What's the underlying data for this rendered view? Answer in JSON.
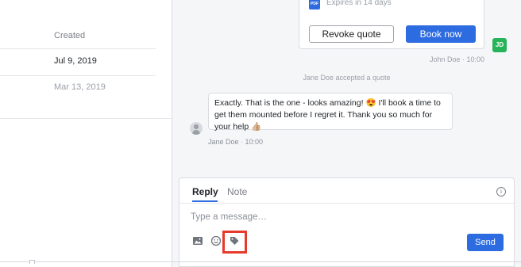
{
  "left_table": {
    "column_header": "Created",
    "rows": [
      {
        "date": "Jul 9, 2019",
        "color": "#1f2328"
      },
      {
        "date": "Mar 13, 2019",
        "color": "#9aa0a8"
      }
    ]
  },
  "quote_card": {
    "pdf_badge": "PDF",
    "expires": "Expires in 14 days",
    "revoke_label": "Revoke quote",
    "book_label": "Book now"
  },
  "conversation": {
    "agent_initials": "JD",
    "agent_meta": "John Doe · 10:00",
    "system_message": "Jane Doe accepted a quote",
    "customer_message": "Exactly. That is the one - looks amazing! 😍 I'll book a time to get them mounted before I regret it. Thank you so much for your help 👍🏼",
    "customer_meta": "Jane Doe · 10:00"
  },
  "composer": {
    "tabs": [
      "Reply",
      "Note"
    ],
    "active_tab": "Reply",
    "info_glyph": "i",
    "placeholder": "Type a message…",
    "send_label": "Send",
    "tools": [
      "image-icon",
      "emoji-icon",
      "tag-icon"
    ]
  },
  "colors": {
    "accent": "#2d6be0",
    "agent_avatar": "#27b35a",
    "highlight": "#e53a2c"
  }
}
